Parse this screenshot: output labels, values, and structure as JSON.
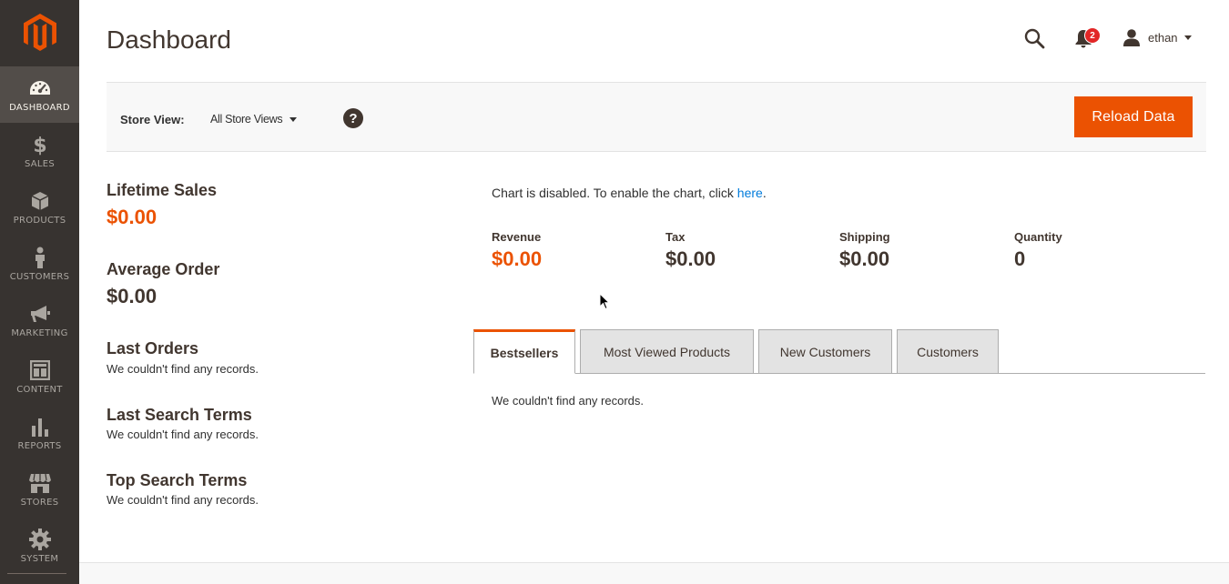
{
  "sidebar": {
    "items": [
      {
        "label": "DASHBOARD",
        "icon": "dashboard-icon",
        "active": true
      },
      {
        "label": "SALES",
        "icon": "dollar-icon"
      },
      {
        "label": "PRODUCTS",
        "icon": "box-icon"
      },
      {
        "label": "CUSTOMERS",
        "icon": "person-icon"
      },
      {
        "label": "MARKETING",
        "icon": "megaphone-icon"
      },
      {
        "label": "CONTENT",
        "icon": "layout-icon"
      },
      {
        "label": "REPORTS",
        "icon": "bar-chart-icon"
      },
      {
        "label": "STORES",
        "icon": "storefront-icon"
      },
      {
        "label": "SYSTEM",
        "icon": "gear-icon"
      }
    ]
  },
  "header": {
    "title": "Dashboard",
    "notification_count": "2",
    "user_name": "ethan"
  },
  "store_bar": {
    "label": "Store View:",
    "selected": "All Store Views",
    "help": "?",
    "reload_label": "Reload Data"
  },
  "left_stats": {
    "lifetime_sales": {
      "title": "Lifetime Sales",
      "value": "$0.00"
    },
    "average_order": {
      "title": "Average Order",
      "value": "$0.00"
    },
    "last_orders": {
      "title": "Last Orders",
      "empty": "We couldn't find any records."
    },
    "last_search_terms": {
      "title": "Last Search Terms",
      "empty": "We couldn't find any records."
    },
    "top_search_terms": {
      "title": "Top Search Terms",
      "empty": "We couldn't find any records."
    }
  },
  "chart": {
    "message_prefix": "Chart is disabled. To enable the chart, click ",
    "link_text": "here",
    "message_suffix": "."
  },
  "totals": [
    {
      "label": "Revenue",
      "value": "$0.00"
    },
    {
      "label": "Tax",
      "value": "$0.00"
    },
    {
      "label": "Shipping",
      "value": "$0.00"
    },
    {
      "label": "Quantity",
      "value": "0"
    }
  ],
  "tabs": [
    {
      "label": "Bestsellers",
      "active": true
    },
    {
      "label": "Most Viewed Products"
    },
    {
      "label": "New Customers"
    },
    {
      "label": "Customers"
    }
  ],
  "tab_content": {
    "empty": "We couldn't find any records."
  },
  "colors": {
    "accent": "#eb5202",
    "sidebar_bg": "#373330",
    "link": "#007bdb"
  }
}
